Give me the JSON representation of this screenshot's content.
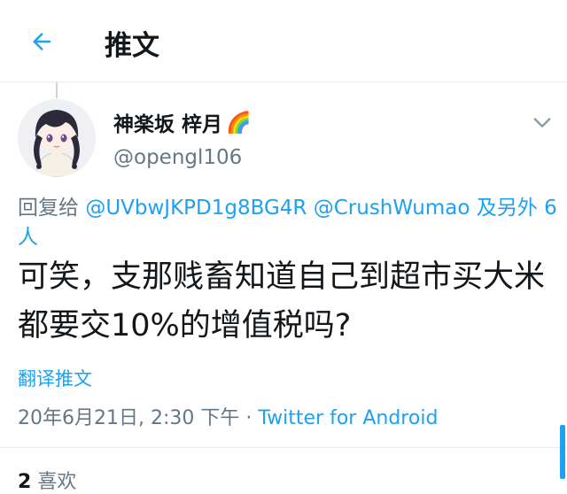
{
  "header": {
    "title": "推文"
  },
  "tweet": {
    "display_name": "神楽坂 梓月",
    "name_emoji": "🌈",
    "handle": "@opengl106",
    "reply_prefix": "回复给",
    "mention_1": "@UVbwJKPD1g8BG4R",
    "mention_2": "@CrushWumao",
    "reply_suffix": "及另外 6 人",
    "text": "可笑，支那贱畜知道自己到超市买大米都要交10%的增值税吗?",
    "translate_label": "翻译推文",
    "timestamp": "20年6月21日, 2:30 下午",
    "separator": "·",
    "source": "Twitter for Android"
  },
  "stats": {
    "likes_count": "2",
    "likes_label": "喜欢"
  },
  "icons": {
    "back": "arrow-left-icon",
    "caret": "chevron-down-icon",
    "avatar": "anime-avatar"
  },
  "colors": {
    "accent": "#1da1f2",
    "text_primary": "#14171a",
    "text_secondary": "#657786",
    "divider": "#e6ecf0"
  }
}
